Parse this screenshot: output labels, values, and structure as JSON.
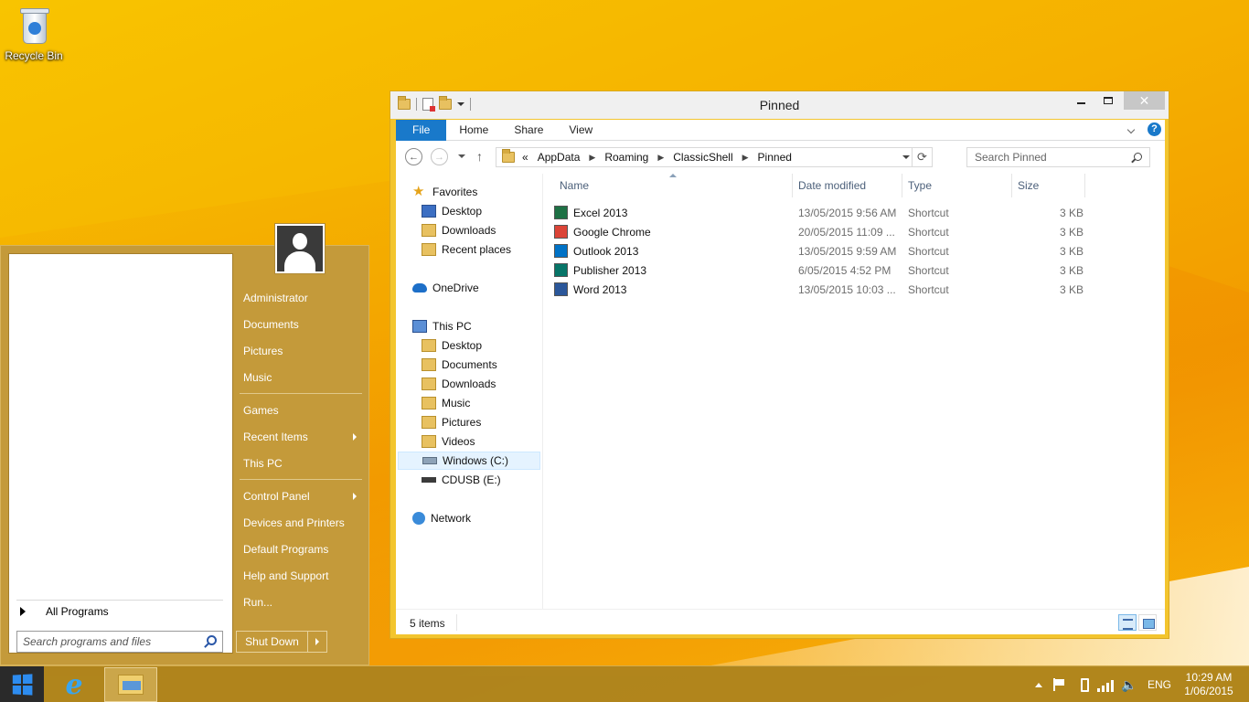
{
  "desktop": {
    "recycle_bin_label": "Recycle Bin"
  },
  "start_menu": {
    "all_programs_label": "All Programs",
    "search_placeholder": "Search programs and files",
    "items": [
      {
        "label": "Administrator"
      },
      {
        "label": "Documents"
      },
      {
        "label": "Pictures"
      },
      {
        "label": "Music"
      },
      {
        "label": "Games"
      },
      {
        "label": "Recent Items",
        "submenu": true
      },
      {
        "label": "This PC"
      },
      {
        "label": "Control Panel",
        "submenu": true
      },
      {
        "label": "Devices and Printers"
      },
      {
        "label": "Default Programs"
      },
      {
        "label": "Help and Support"
      },
      {
        "label": "Run..."
      }
    ],
    "shutdown_label": "Shut Down"
  },
  "explorer": {
    "title": "Pinned",
    "ribbon_tabs": [
      "File",
      "Home",
      "Share",
      "View"
    ],
    "address_prefix": "«",
    "breadcrumbs": [
      "AppData",
      "Roaming",
      "ClassicShell",
      "Pinned"
    ],
    "search_placeholder": "Search Pinned",
    "nav_tree": {
      "favorites": {
        "label": "Favorites",
        "children": [
          "Desktop",
          "Downloads",
          "Recent places"
        ]
      },
      "onedrive": {
        "label": "OneDrive"
      },
      "this_pc": {
        "label": "This PC",
        "children": [
          "Desktop",
          "Documents",
          "Downloads",
          "Music",
          "Pictures",
          "Videos",
          "Windows (C:)",
          "CDUSB (E:)"
        ]
      },
      "network": {
        "label": "Network"
      }
    },
    "columns": {
      "name": "Name",
      "date": "Date modified",
      "type": "Type",
      "size": "Size"
    },
    "files": [
      {
        "name": "Excel 2013",
        "date": "13/05/2015 9:56 AM",
        "type": "Shortcut",
        "size": "3 KB",
        "color": "#1e7145"
      },
      {
        "name": "Google Chrome",
        "date": "20/05/2015 11:09 ...",
        "type": "Shortcut",
        "size": "3 KB",
        "color": "#db4437"
      },
      {
        "name": "Outlook 2013",
        "date": "13/05/2015 9:59 AM",
        "type": "Shortcut",
        "size": "3 KB",
        "color": "#0072c6"
      },
      {
        "name": "Publisher 2013",
        "date": "6/05/2015 4:52 PM",
        "type": "Shortcut",
        "size": "3 KB",
        "color": "#077568"
      },
      {
        "name": "Word 2013",
        "date": "13/05/2015 10:03 ...",
        "type": "Shortcut",
        "size": "3 KB",
        "color": "#2b579a"
      }
    ],
    "status_count": "5 items",
    "close_glyph": "✕"
  },
  "taskbar": {
    "language": "ENG",
    "time": "10:29 AM",
    "date": "1/06/2015",
    "ie_glyph": "e"
  }
}
